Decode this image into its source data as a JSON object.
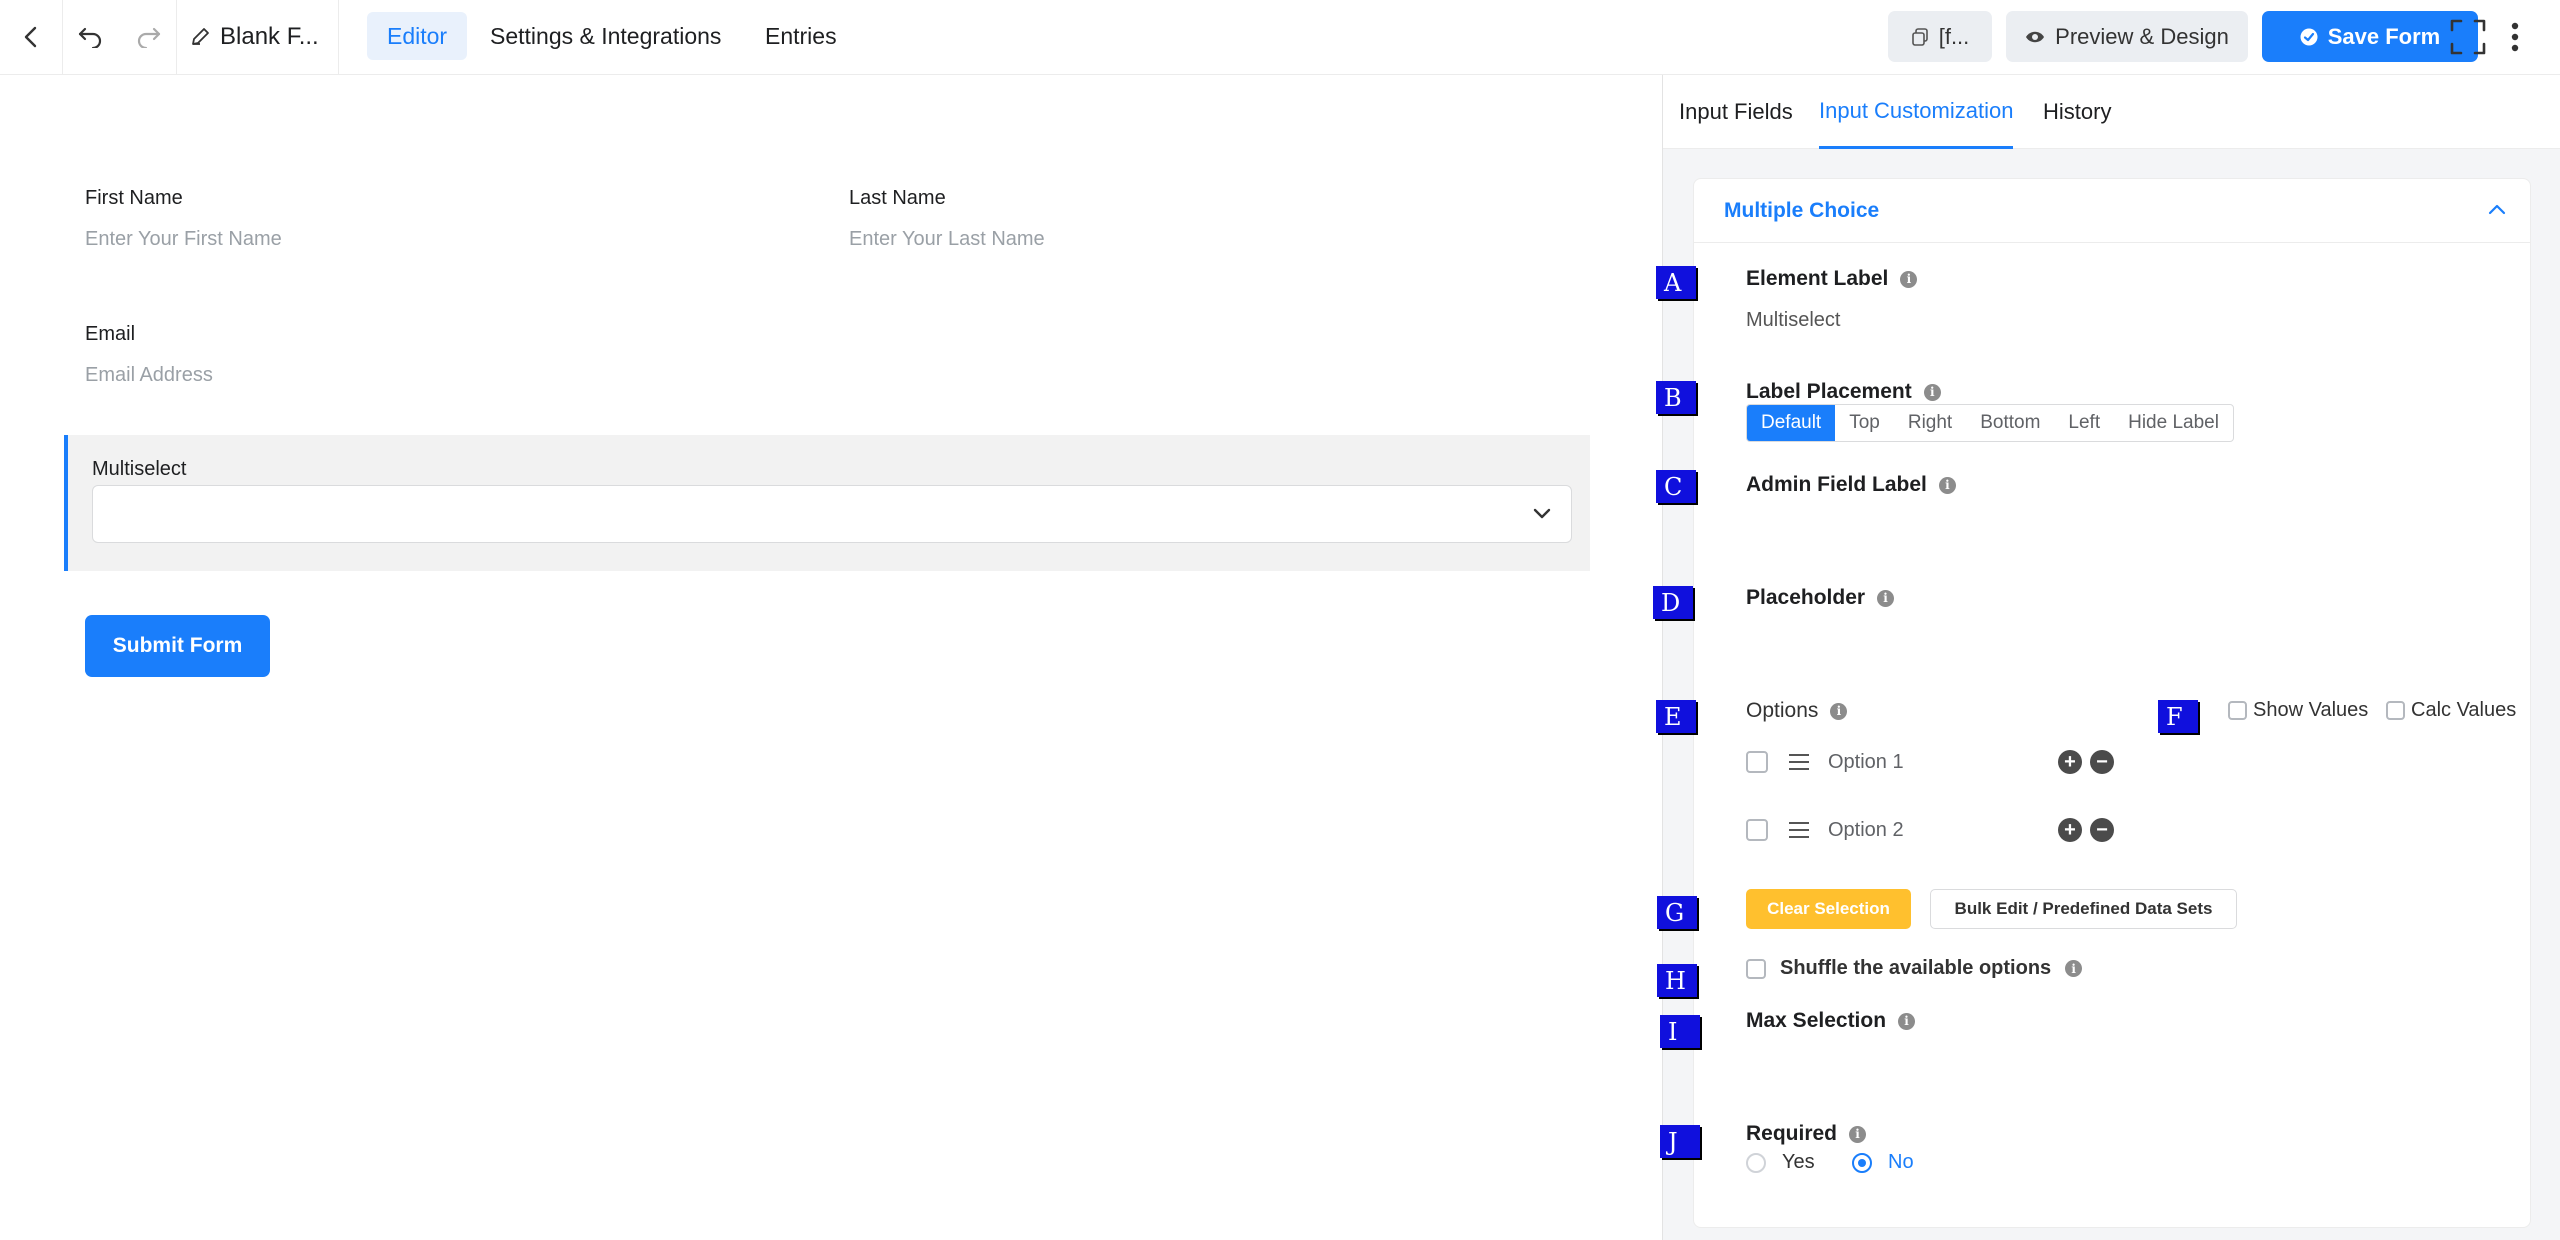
{
  "topbar": {
    "form_title": "Blank F...",
    "nav_tabs": [
      "Editor",
      "Settings & Integrations",
      "Entries"
    ],
    "shortcode_label": "[f...",
    "preview_label": "Preview & Design",
    "save_label": "Save Form"
  },
  "form": {
    "first_name_label": "First Name",
    "first_name_placeholder": "Enter Your First Name",
    "last_name_label": "Last Name",
    "last_name_placeholder": "Enter Your Last Name",
    "email_label": "Email",
    "email_placeholder": "Email Address",
    "multiselect_label": "Multiselect",
    "submit_label": "Submit Form"
  },
  "panel": {
    "tabs": [
      "Input Fields",
      "Input Customization",
      "History"
    ],
    "section_title": "Multiple Choice",
    "element_label_title": "Element Label",
    "element_label_value": "Multiselect",
    "label_placement_title": "Label Placement",
    "label_placement_options": [
      "Default",
      "Top",
      "Right",
      "Bottom",
      "Left",
      "Hide Label"
    ],
    "label_placement_selected": "Default",
    "admin_field_label_title": "Admin Field Label",
    "placeholder_title": "Placeholder",
    "options_title": "Options",
    "show_values_label": "Show Values",
    "calc_values_label": "Calc Values",
    "options": [
      "Option 1",
      "Option 2"
    ],
    "clear_selection_label": "Clear Selection",
    "bulk_edit_label": "Bulk Edit / Predefined Data Sets",
    "shuffle_label": "Shuffle the available options",
    "max_selection_title": "Max Selection",
    "required_title": "Required",
    "required_yes": "Yes",
    "required_no": "No",
    "required_selected": "No"
  },
  "markers": [
    "A",
    "B",
    "C",
    "D",
    "E",
    "F",
    "G",
    "H",
    "I",
    "J"
  ],
  "colors": {
    "accent": "#1a7efb",
    "warning": "#ffc02e",
    "marker": "#1010dd"
  }
}
